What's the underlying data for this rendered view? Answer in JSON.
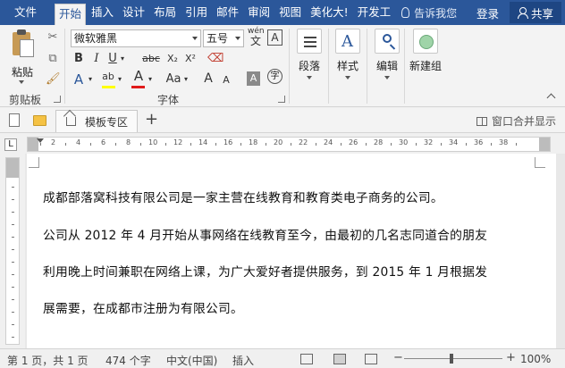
{
  "ribbon_tabs": [
    "文件",
    "开始",
    "插入",
    "设计",
    "布局",
    "引用",
    "邮件",
    "审阅",
    "视图",
    "美化大!",
    "开发工"
  ],
  "tell_me": "告诉我您",
  "login": "登录",
  "share": "共享",
  "clipboard": {
    "paste": "粘贴",
    "group": "剪贴板"
  },
  "font": {
    "family": "微软雅黑",
    "size": "五号",
    "wen": "wén",
    "wen_char": "文",
    "bold": "B",
    "italic": "I",
    "underline": "U",
    "strike": "abc",
    "sub": "X₂",
    "sup": "X²",
    "grow": "A",
    "shrink": "A",
    "aa": "Aa",
    "group": "字体"
  },
  "big_buttons": [
    "段落",
    "样式",
    "编辑",
    "新建组"
  ],
  "doc_tabs": {
    "template": "模板专区",
    "merge": "窗口合并显示"
  },
  "ruler_numbers": [
    "2",
    "4",
    "6",
    "8",
    "10",
    "12",
    "14",
    "16",
    "18",
    "20",
    "22",
    "24",
    "26",
    "28",
    "30",
    "32",
    "34",
    "36",
    "38"
  ],
  "document": {
    "p1": "成都部落窝科技有限公司是一家主营在线教育和教育类电子商务的公司。",
    "p2_l1": "公司从 2012 年 4 月开始从事网络在线教育至今，由最初的几名志同道合的朋友",
    "p2_l2": "利用晚上时间兼职在网络上课，为广大爱好者提供服务，到 2015 年 1 月根据发",
    "p2_l3": "展需要，在成都市注册为有限公司。"
  },
  "status": {
    "page": "第 1 页，共 1 页",
    "words": "474 个字",
    "lang": "中文(中国)",
    "mode": "插入",
    "zoom": "100%",
    "zoom_minus": "−",
    "zoom_plus": "+"
  },
  "colors": {
    "accent": "#2b579a",
    "highlight": "#ffff00",
    "font_color": "#e01b1b"
  }
}
